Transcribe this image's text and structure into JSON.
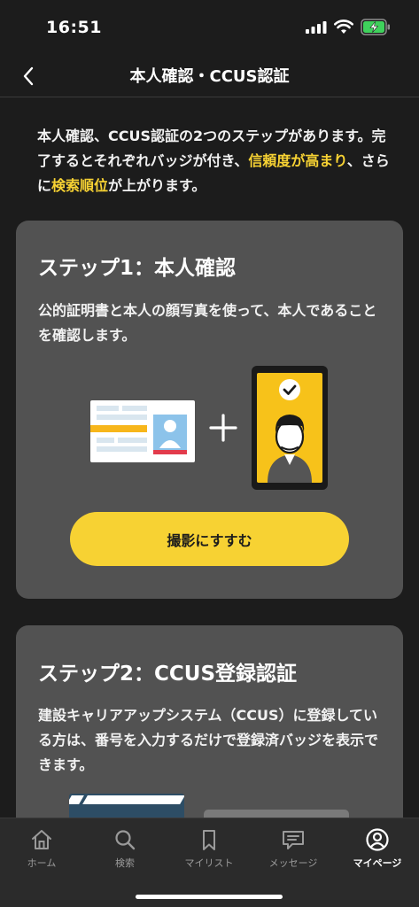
{
  "status_bar": {
    "time": "16:51"
  },
  "header": {
    "title": "本人確認・CCUS認証",
    "back_icon": "chevron-left-icon"
  },
  "intro": {
    "text_1": "本人確認、CCUS認証の2つのステップがあります。完了するとそれぞれバッジが付き、",
    "highlight_1": "信頼度が高まり",
    "text_2": "、さらに",
    "highlight_2": "検索順位",
    "text_3": "が上がります。"
  },
  "step1": {
    "title": "ステップ1：本人確認",
    "description": "公的証明書と本人の顔写真を使って、本人であることを確認します。",
    "button_label": "撮影にすすむ"
  },
  "step2": {
    "title": "ステップ2：CCUS登録認証",
    "description": "建設キャリアアップシステム（CCUS）に登録している方は、番号を入力するだけで登録済バッジを表示できます。"
  },
  "tab_bar": {
    "items": [
      {
        "label": "ホーム",
        "icon": "home-icon",
        "active": false
      },
      {
        "label": "検索",
        "icon": "search-icon",
        "active": false
      },
      {
        "label": "マイリスト",
        "icon": "bookmark-icon",
        "active": false
      },
      {
        "label": "メッセージ",
        "icon": "message-icon",
        "active": false
      },
      {
        "label": "マイページ",
        "icon": "user-icon",
        "active": true
      }
    ]
  },
  "colors": {
    "background": "#1c1c1c",
    "card": "#525252",
    "accent": "#f7d233",
    "tab_bar": "#2b2b2b"
  }
}
